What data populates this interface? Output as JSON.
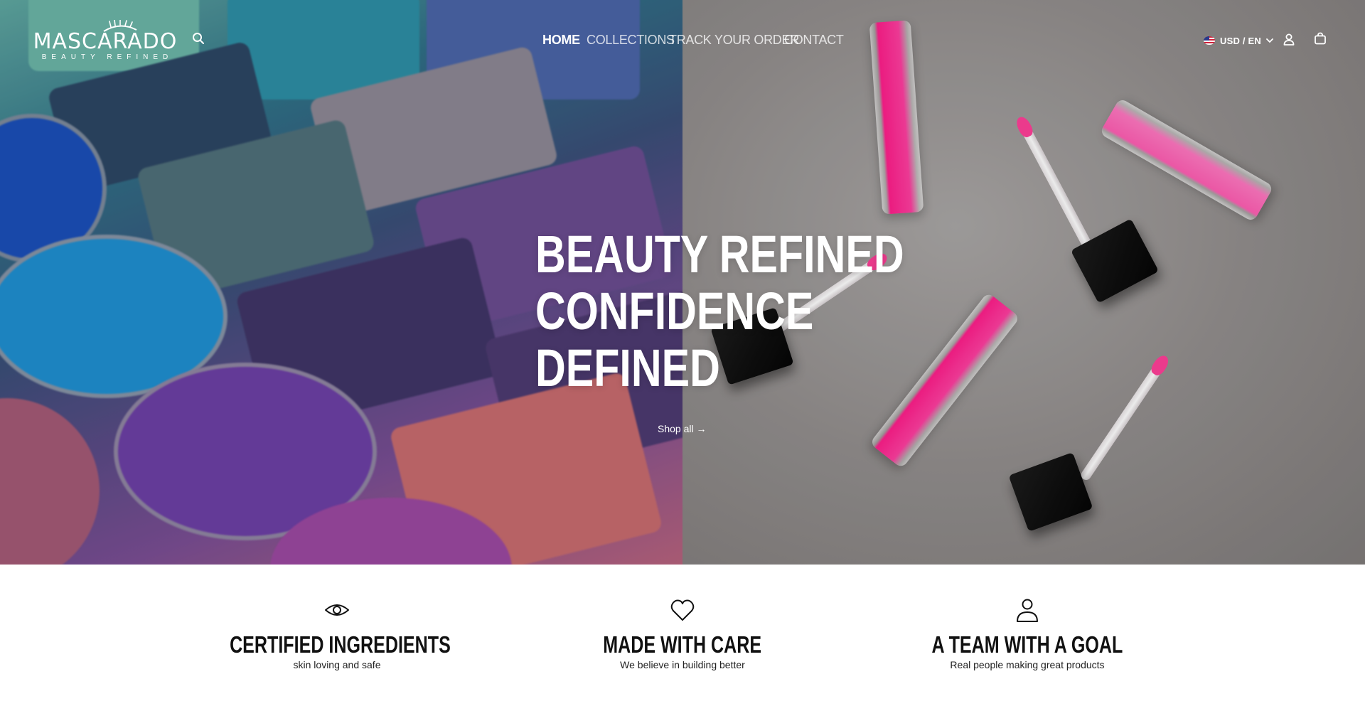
{
  "brand": {
    "name": "MASCARADO",
    "tagline": "BEAUTY REFINED"
  },
  "nav": {
    "items": [
      {
        "label": "HOME",
        "active": true
      },
      {
        "label": "COLLECTIONS",
        "active": false
      },
      {
        "label": "TRACK YOUR ORDER",
        "active": false
      },
      {
        "label": "CONTACT",
        "active": false
      }
    ]
  },
  "header": {
    "locale_label": "USD / EN",
    "icons": [
      "search-icon",
      "flag-us-icon",
      "chevron-down-icon",
      "account-icon",
      "cart-icon"
    ]
  },
  "hero": {
    "title_lines": [
      "BEAUTY REFINED",
      "CONFIDENCE",
      "DEFINED"
    ],
    "cta_label": "Shop all →"
  },
  "features": [
    {
      "icon": "eye-icon",
      "title": "CERTIFIED INGREDIENTS",
      "subtitle": "skin loving and safe"
    },
    {
      "icon": "heart-icon",
      "title": "MADE WITH CARE",
      "subtitle": "We believe in building better"
    },
    {
      "icon": "person-icon",
      "title": "A TEAM WITH A GOAL",
      "subtitle": "Real people making great products"
    }
  ],
  "colors": {
    "accent_pink": "#ff1f8c",
    "text_dark": "#111111",
    "header_text": "#ffffff"
  }
}
